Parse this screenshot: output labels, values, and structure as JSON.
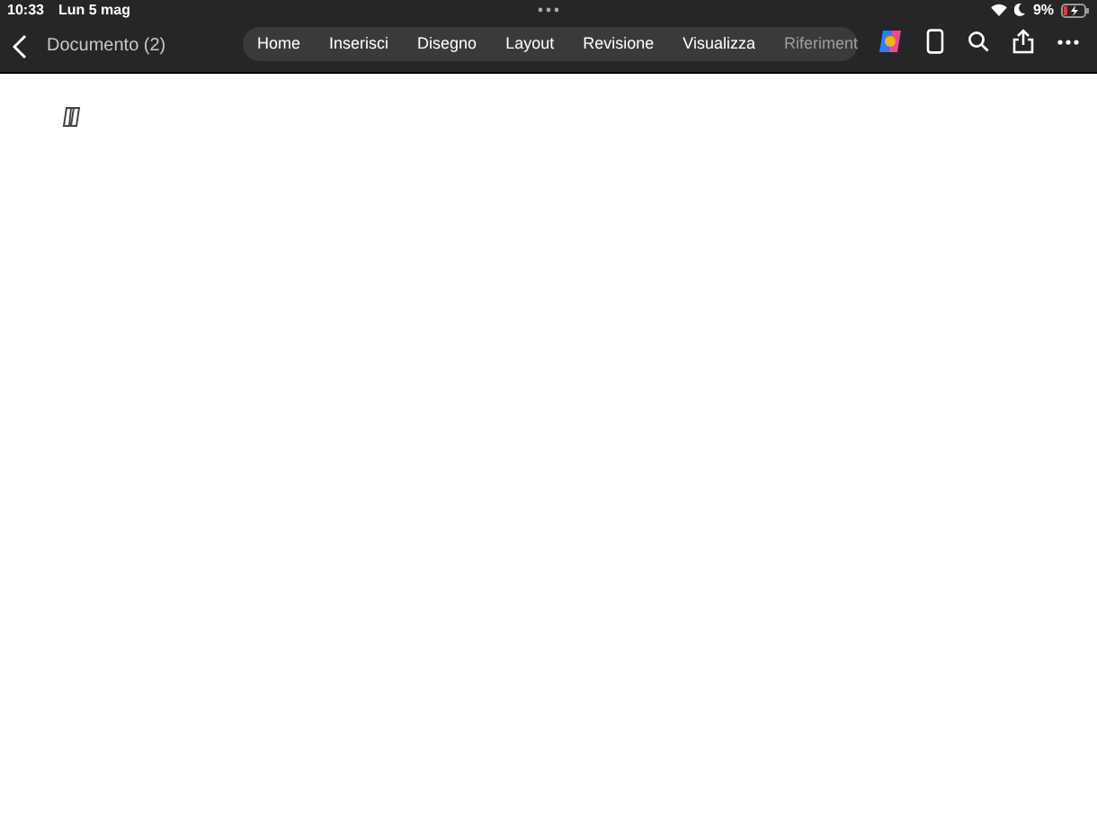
{
  "status_bar": {
    "time": "10:33",
    "date": "Lun 5 mag",
    "battery": "9%"
  },
  "toolbar": {
    "title": "Documento (2)",
    "tabs": [
      {
        "label": "Home"
      },
      {
        "label": "Inserisci"
      },
      {
        "label": "Disegno"
      },
      {
        "label": "Layout"
      },
      {
        "label": "Revisione"
      },
      {
        "label": "Visualizza"
      },
      {
        "label": "Riferiment"
      }
    ]
  }
}
